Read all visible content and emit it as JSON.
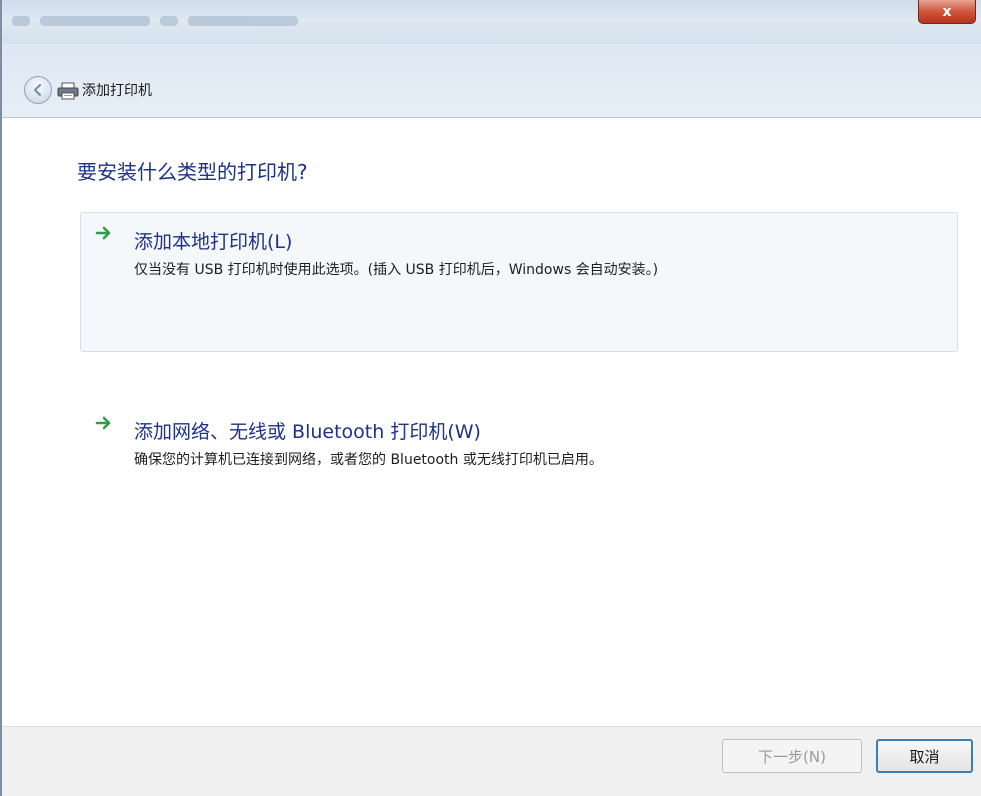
{
  "window": {
    "title": "添加打印机",
    "close_label": "x"
  },
  "main": {
    "heading": "要安装什么类型的打印机?",
    "options": [
      {
        "title": "添加本地打印机(L)",
        "description": "仅当没有 USB 打印机时使用此选项。(插入 USB 打印机后，Windows 会自动安装。)",
        "icon": "green-arrow-icon"
      },
      {
        "title": "添加网络、无线或 Bluetooth 打印机(W)",
        "description": "确保您的计算机已连接到网络，或者您的 Bluetooth 或无线打印机已启用。",
        "icon": "green-arrow-icon"
      }
    ]
  },
  "footer": {
    "next_label": "下一步(N)",
    "cancel_label": "取消"
  },
  "colors": {
    "heading": "#1e3287",
    "arrow": "#2ea043",
    "title_bar": "#d6e1ee",
    "close_button": "#c7452b"
  }
}
